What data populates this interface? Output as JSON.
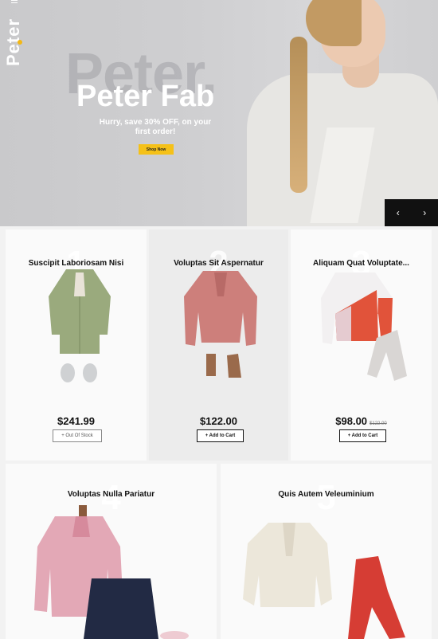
{
  "brand": {
    "logo": "Peter"
  },
  "hero": {
    "ghost_text": "Peter.",
    "title": "Peter Fab",
    "subtitle": "Hurry, save 30% OFF, on your first order!",
    "cta": "Shop Now",
    "prev_icon": "‹",
    "next_icon": "›"
  },
  "products": [
    {
      "rank": "1",
      "name": "Suscipit Laboriosam Nisi",
      "price": "$241.99",
      "button": "+ Out Of Stock",
      "old_price": ""
    },
    {
      "rank": "2",
      "name": "Voluptas Sit Aspernatur",
      "price": "$122.00",
      "button": "+ Add to Cart",
      "old_price": ""
    },
    {
      "rank": "3",
      "name": "Aliquam Quat Voluptate...",
      "price": "$98.00",
      "button": "+ Add to Cart",
      "old_price": "$122.00"
    },
    {
      "rank": "4",
      "name": "Voluptas Nulla Pariatur"
    },
    {
      "rank": "5",
      "name": "Quis Autem Veleuminium"
    }
  ],
  "colors": {
    "accent": "#f5c118",
    "dark": "#111111"
  }
}
